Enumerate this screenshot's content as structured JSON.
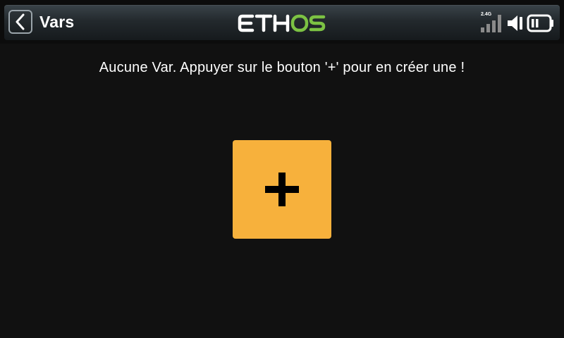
{
  "header": {
    "title": "Vars",
    "logo_text": "ETHOS",
    "rf_band": "2.4G"
  },
  "status": {
    "signal_bars_lit": 0,
    "signal_bars_total": 4
  },
  "main": {
    "empty_message": "Aucune Var. Appuyer sur le bouton '+' pour en créer une !",
    "add_button_label": "+"
  },
  "colors": {
    "background": "#111111",
    "accent": "#f7b13c",
    "logo_green": "#7cc243",
    "header": "#2a3236"
  },
  "icons": {
    "back": "chevron-left-icon",
    "add": "plus-icon",
    "signal": "signal-bars-icon",
    "speaker": "speaker-icon",
    "battery": "battery-icon"
  }
}
